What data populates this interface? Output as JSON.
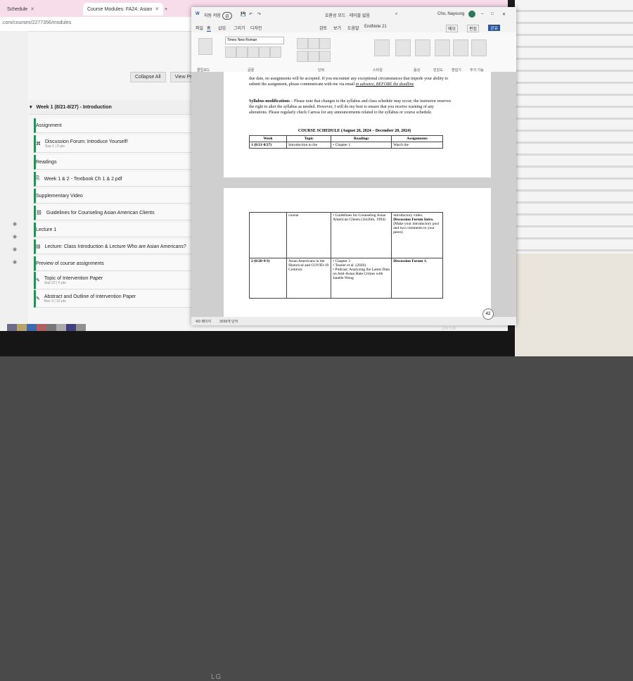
{
  "browser": {
    "tabs": [
      {
        "label": "Schedule"
      },
      {
        "label": "Course Modules: FA24: Asian"
      }
    ],
    "url": ".com/courses/2277356/modules"
  },
  "canvas": {
    "collapse_all": "Collapse All",
    "view_progress": "View Pro",
    "modules": [
      {
        "label": "Week 1 (8/21-8/27) - Introduction",
        "kind": "header"
      },
      {
        "label": "Assignment",
        "kind": "section"
      },
      {
        "label": "Discussion Forum: Introduce Yourself!",
        "meta": "Sep 1 | 0 pts",
        "kind": "item"
      },
      {
        "label": "Readings",
        "kind": "section"
      },
      {
        "label": "Week 1 & 2 - Textbook Ch 1 & 2.pdf",
        "kind": "item"
      },
      {
        "label": "Supplementary Video",
        "kind": "section"
      },
      {
        "label": "Guidelines for Counseling Asian American Clients",
        "kind": "item"
      },
      {
        "label": "Lecture 1",
        "kind": "section"
      },
      {
        "label": "Lecture: Class Introduction & Lecture Who are Asian Americans?",
        "kind": "item"
      },
      {
        "label": "Preview of course assignments",
        "kind": "section"
      },
      {
        "label": "Topic of Intervention Paper",
        "meta": "Sep 22 | 5 pts",
        "kind": "item"
      },
      {
        "label": "Abstract and Outline of Intervention Paper",
        "meta": "Nov 3 | 10 pts",
        "kind": "item"
      }
    ]
  },
  "word": {
    "autosave": "자동 저장",
    "toggle_state": "끔",
    "title": "호환성 모드 · 레이블 없음",
    "user": "Cho, Nayoung",
    "ribbon_tabs": [
      "파일",
      "홈",
      "삽입",
      "그리기",
      "디자인",
      "검토",
      "보기",
      "도움말",
      "EndNote 21"
    ],
    "comment_btn": "메모",
    "edit_btn": "편집",
    "share_btn": "공유",
    "font_name": "Times New Roman",
    "groups": [
      "클립보드",
      "글꼴",
      "단락",
      "스타일",
      "음성",
      "민감도",
      "편집기",
      "추가 기능"
    ],
    "page1_para1": "due date, no assignments will be accepted. If you encounter any exceptional circumstances that impede your ability to submit the assignment, please communicate with me via email",
    "page1_para1_em": "in advance, BEFORE the deadline",
    "syllabus_mod_label": "Syllabus modifications",
    "syllabus_mod_text": " – Please note that changes to the syllabus and class schedule may occur; the instructor reserves the right to alter the syllabus as needed. However, I will do my best to ensure that you receive warning of any alterations. Please regularly check Canvas for any announcements related to the syllabus or course schedule.",
    "schedule_title": "COURSE SCHEDULE (August 26, 2024 – December 20, 2024)",
    "schedule_headers": [
      "Week",
      "Topic",
      "Readings",
      "Assignments"
    ],
    "row1": [
      "1 (8/21-8/27)",
      "Introduction to the",
      "Chapter 1",
      "Watch the"
    ],
    "p2_row_topic": "course",
    "p2_row_readings": "Guidelines for Counseling Asian American Clients (1hr26m, 1994)",
    "p2_row_assign1": "introductory video.",
    "p2_row_assign2": "Discussion Forum Intro.",
    "p2_row_assign3": "(Make your introductory post and two comments to your peers)",
    "row2_week": "2 (8/28-9/3)",
    "row2_topic": "Asian Americans in the Historical and COVID-19 Contexts",
    "row2_readings": [
      "Chapter 2",
      "Tessler et al. (2020)",
      "Podcast: Analyzing the Latest Data on Anti-Asian Hate Crimes with Janelle Wong"
    ],
    "row2_assign": "Discussion Forum 1.",
    "status_page": "4/9 페이지",
    "status_words": "3038개 단어",
    "zoom_badge": "42",
    "clock_time": "오후 5:45",
    "clock_date": "2024-07-30"
  },
  "monitor_brand": "LG"
}
